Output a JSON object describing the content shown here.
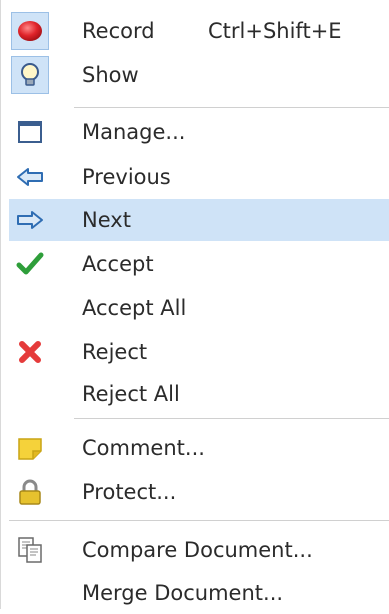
{
  "menu": {
    "items": [
      {
        "label": "Record",
        "shortcut": "Ctrl+Shift+E",
        "icon": "record-icon"
      },
      {
        "label": "Show",
        "icon": "lightbulb-icon"
      },
      {
        "label": "Manage...",
        "icon": "window-icon"
      },
      {
        "label": "Previous",
        "icon": "arrow-left-icon"
      },
      {
        "label": "Next",
        "icon": "arrow-right-icon"
      },
      {
        "label": "Accept",
        "icon": "checkmark-icon"
      },
      {
        "label": "Accept All"
      },
      {
        "label": "Reject",
        "icon": "reject-x-icon"
      },
      {
        "label": "Reject All"
      },
      {
        "label": "Comment...",
        "icon": "sticky-note-icon"
      },
      {
        "label": "Protect...",
        "icon": "lock-icon"
      },
      {
        "label": "Compare Document...",
        "icon": "compare-document-icon"
      },
      {
        "label": "Merge Document..."
      }
    ],
    "selected_item": "Next",
    "colors": {
      "highlight": "#cfe3f7",
      "highlight_border": "#9cc0e6",
      "text": "#2b2b2b",
      "separator": "#d0d0d0"
    }
  }
}
